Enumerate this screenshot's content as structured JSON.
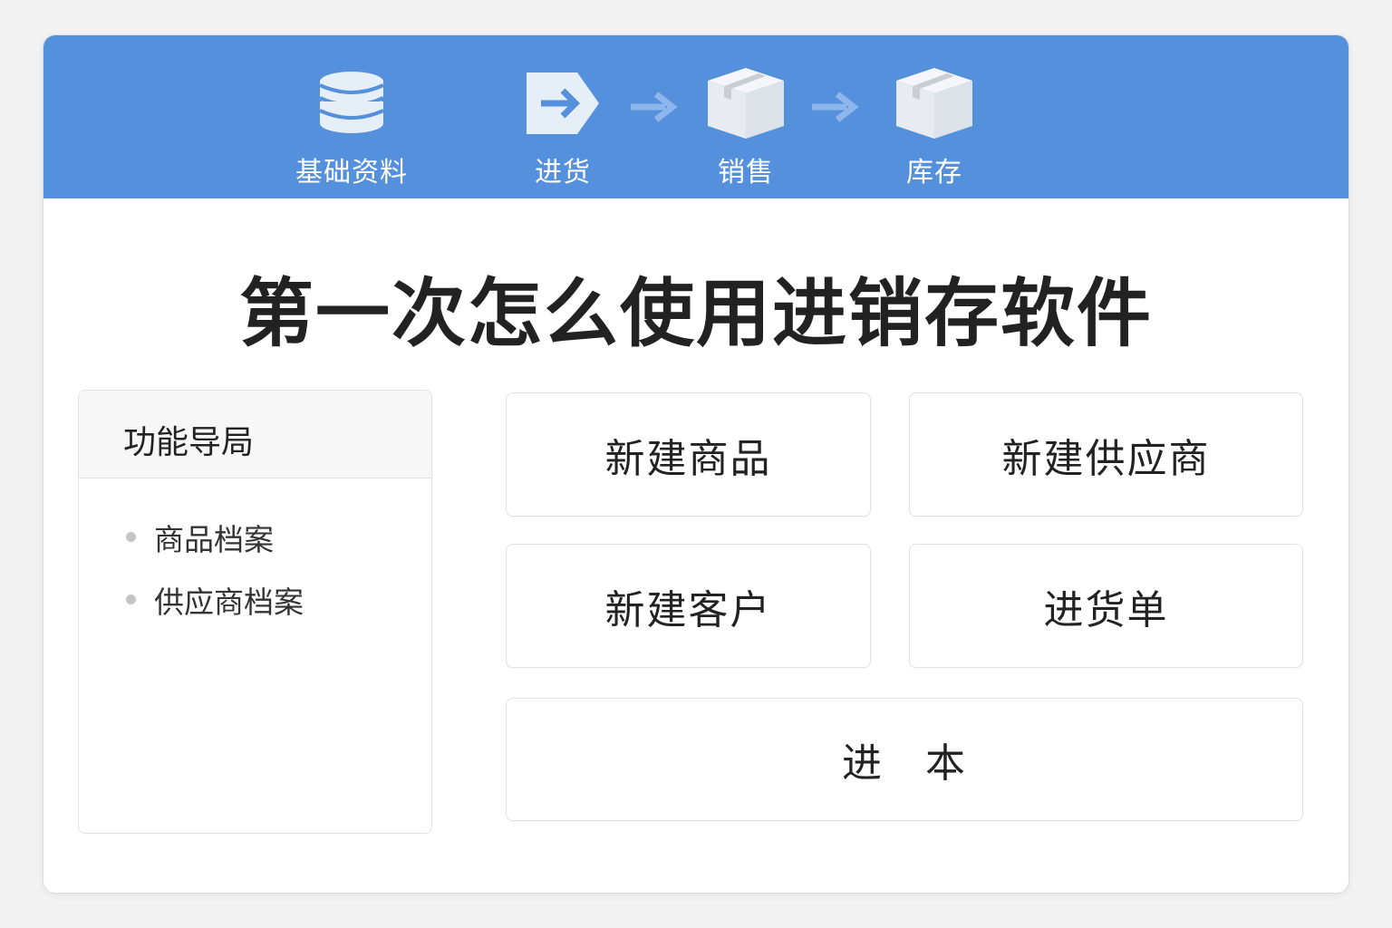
{
  "header": {
    "steps": [
      {
        "label": "基础资料",
        "icon": "database-icon"
      },
      {
        "label": "进货",
        "icon": "arrow-in-icon"
      },
      {
        "label": "销售",
        "icon": "box-icon"
      },
      {
        "label": "库存",
        "icon": "box-icon"
      }
    ],
    "color": "#5590dc"
  },
  "title": "第一次怎么使用进销存软件",
  "sidebar": {
    "title": "功能导局",
    "items": [
      {
        "label": "商品档案"
      },
      {
        "label": "供应商档案"
      }
    ]
  },
  "actions": [
    {
      "label": "新建商品"
    },
    {
      "label": "新建供应商"
    },
    {
      "label": "新建客户"
    },
    {
      "label": "进货单"
    },
    {
      "label": "进　本"
    }
  ]
}
